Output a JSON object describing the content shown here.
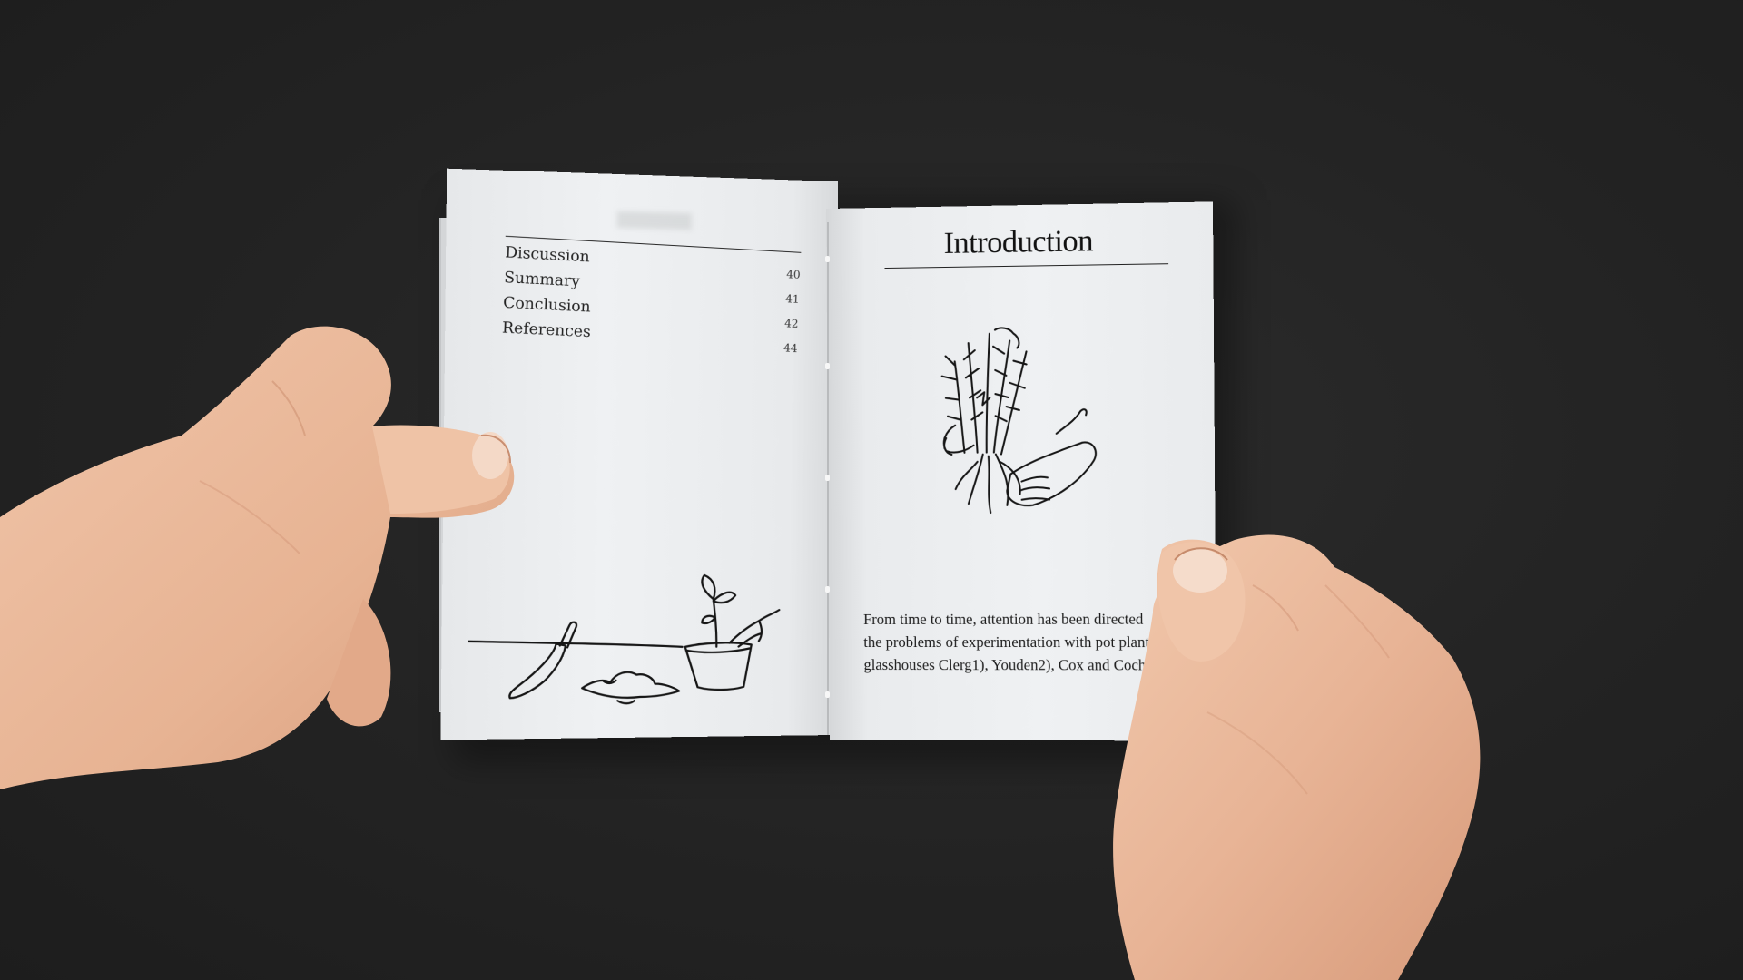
{
  "booklet": {
    "contents": [
      {
        "label": "Discussion",
        "page": "40"
      },
      {
        "label": "Summary",
        "page": "41"
      },
      {
        "label": "Conclusion",
        "page": "42"
      },
      {
        "label": "References",
        "page": "44"
      }
    ],
    "right_page": {
      "title": "Introduction",
      "body_lines": [
        "From time to time, attention has been directed",
        "the problems of experimentation with pot plant",
        "glasshouses Clerg1), Youden2), Cox and Cochran"
      ]
    }
  },
  "illustrations": {
    "left_page": "trowel-soil-potted-seedling-drawing",
    "right_page": "hands-holding-uprooted-plant-drawing"
  },
  "colors": {
    "background": "#232323",
    "paper": "#eceef0",
    "ink": "#1a1a1a",
    "skin": "#e8b89c"
  }
}
